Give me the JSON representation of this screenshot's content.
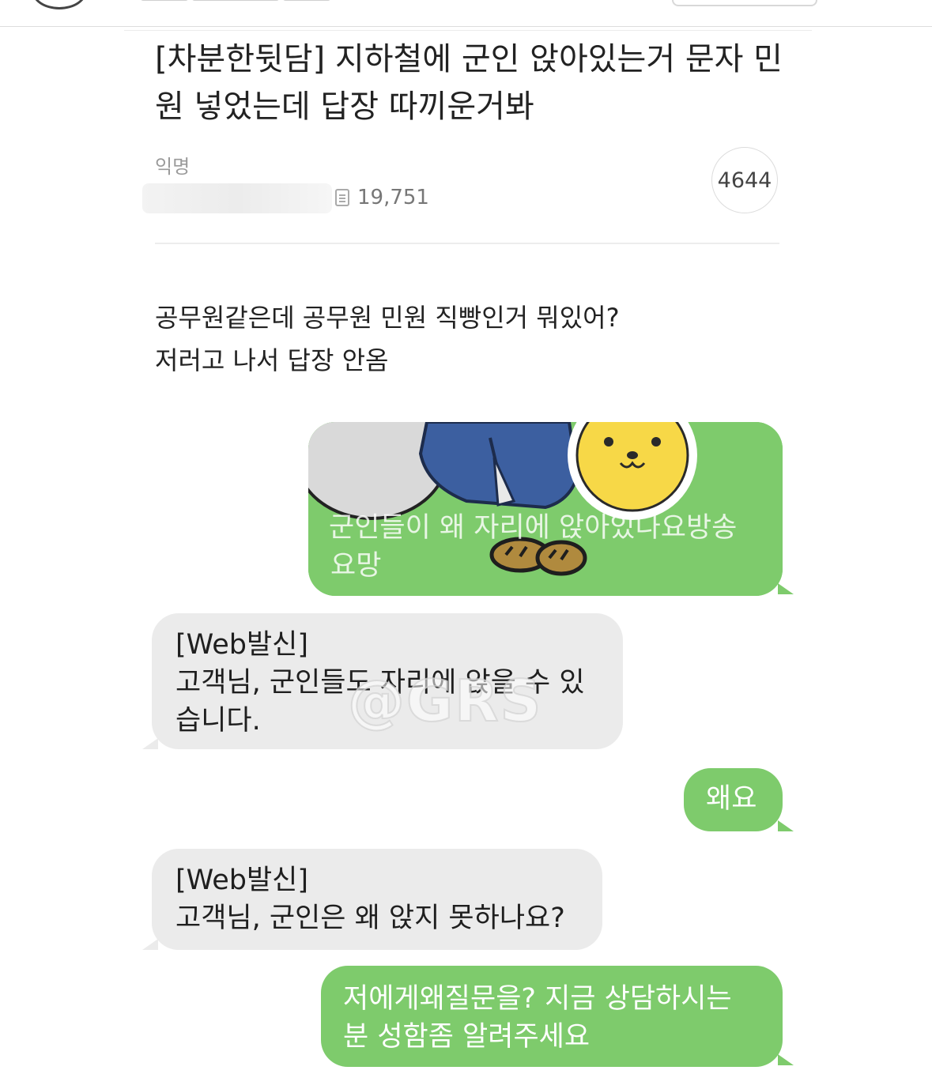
{
  "post": {
    "title": "[차분한뒷담] 지하철에 군인 앉아있는거 문자 민원 넣었는데 답장 따끼운거봐",
    "author": "익명",
    "views": "19,751",
    "comment_count": "4644",
    "body_lines": [
      "공무원같은데 공무원 민원 직빵인거 뭐있어?",
      "저러고 나서 답장 안옴"
    ]
  },
  "chat": {
    "messages": [
      {
        "side": "sent",
        "lines": [
          "군인들이 왜 자리에 앉아있나요방송",
          "요망"
        ]
      },
      {
        "side": "recv",
        "lines": [
          "[Web발신]",
          "고객님, 군인들도 자리에 앉을 수 있",
          "습니다."
        ]
      },
      {
        "side": "sent",
        "lines": [
          "왜요"
        ]
      },
      {
        "side": "recv",
        "lines": [
          "[Web발신]",
          "고객님, 군인은 왜 앉지 못하나요?"
        ]
      },
      {
        "side": "sent",
        "lines": [
          "저에게왜질문을? 지금 상담하시는",
          "분 성함좀 알려주세요"
        ]
      }
    ],
    "watermark": "@GRS",
    "colors": {
      "sent_bubble": "#7ecb6c",
      "received_bubble": "#ebebeb",
      "sticker_face": "#f7d847",
      "sticker_body": "#3c5fa0"
    }
  },
  "icons": {
    "views": "document-icon",
    "sticker": "kakao-character-sticker"
  }
}
